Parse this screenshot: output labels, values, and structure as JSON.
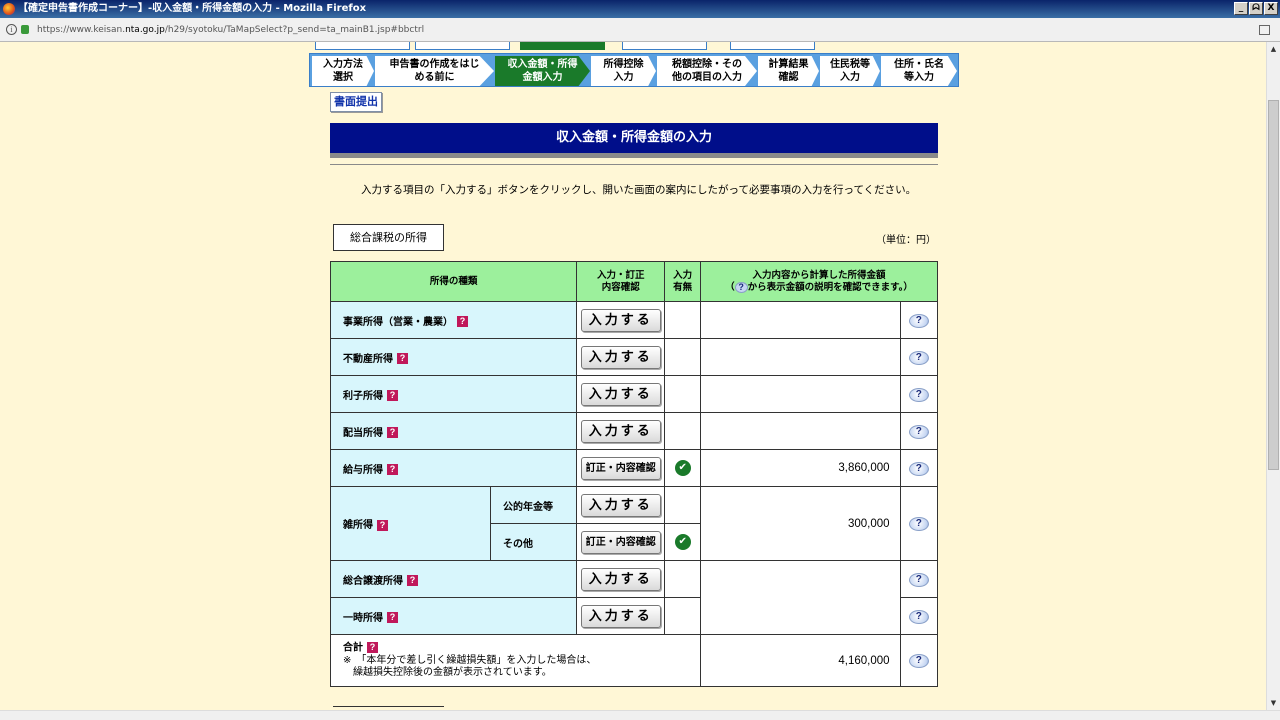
{
  "window": {
    "title": "【確定申告書作成コーナー】-収入金額・所得金額の入力 - Mozilla Firefox",
    "controls": [
      "_",
      "ᗣ",
      "X"
    ]
  },
  "address_bar": {
    "url_prefix": "https://www.keisan.",
    "url_host": "nta.go.jp",
    "url_suffix": "/h29/syotoku/TaMapSelect?p_send=ta_mainB1.jsp#bbctrl"
  },
  "steps": [
    {
      "label1": "入力方法",
      "label2": "選択",
      "current": false
    },
    {
      "label1": "申告書の作成をはじ",
      "label2": "める前に",
      "current": false
    },
    {
      "label1": "収入金額・所得",
      "label2": "金額入力",
      "current": true
    },
    {
      "label1": "所得控除",
      "label2": "入力",
      "current": false
    },
    {
      "label1": "税額控除・その",
      "label2": "他の項目の入力",
      "current": false
    },
    {
      "label1": "計算結果",
      "label2": "確認",
      "current": false
    },
    {
      "label1": "住民税等",
      "label2": "入力",
      "current": false
    },
    {
      "label1": "住所・氏名",
      "label2": "等入力",
      "current": false
    }
  ],
  "paper_submit_label": "書面提出",
  "page_title": "収入金額・所得金額の入力",
  "instruction": "入力する項目の「入力する」ボタンをクリックし、開いた画面の案内にしたがって必要事項の入力を行ってください。",
  "section_label": "総合課税の所得",
  "unit_label": "（単位：円）",
  "table": {
    "headers": {
      "type": "所得の種類",
      "action1": "入力・訂正",
      "action2": "内容確認",
      "has1": "入力",
      "has2": "有無",
      "amount1": "入力内容から計算した所得金額",
      "amount2a": "（",
      "amount2b": "から表示金額の説明を確認できます。）"
    },
    "button_input": "入力する",
    "button_fix": "訂正・内容確認",
    "help_glyph": "?",
    "check_glyph": "✔",
    "rows": {
      "business": {
        "label": "事業所得（営業・農業）",
        "amount": ""
      },
      "real_estate": {
        "label": "不動産所得",
        "amount": ""
      },
      "interest": {
        "label": "利子所得",
        "amount": ""
      },
      "dividend": {
        "label": "配当所得",
        "amount": ""
      },
      "salary": {
        "label": "給与所得",
        "amount": "3,860,000"
      },
      "misc": {
        "label": "雑所得",
        "sub1": "公的年金等",
        "sub2": "その他",
        "amount": "300,000"
      },
      "transfer": {
        "label": "総合譲渡所得"
      },
      "temporary": {
        "label": "一時所得"
      },
      "total": {
        "label": "合計",
        "note1": "※　「本年分で差し引く繰越損失額」を入力した場合は、",
        "note2": "　繰越損失控除後の金額が表示されています。",
        "amount": "4,160,000"
      }
    }
  }
}
